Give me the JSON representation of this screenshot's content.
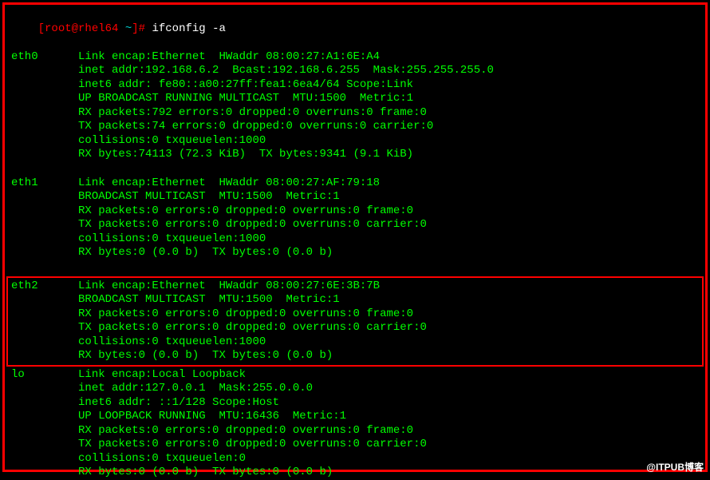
{
  "prompt": {
    "bracket_open": "[",
    "user_host": "root@rhel64",
    "separator": " ",
    "cwd": "~",
    "bracket_close": "]",
    "hash": "# ",
    "command": "ifconfig -a"
  },
  "interfaces": [
    {
      "name": "eth0",
      "lines": [
        "eth0      Link encap:Ethernet  HWaddr 08:00:27:A1:6E:A4",
        "          inet addr:192.168.6.2  Bcast:192.168.6.255  Mask:255.255.255.0",
        "          inet6 addr: fe80::a00:27ff:fea1:6ea4/64 Scope:Link",
        "          UP BROADCAST RUNNING MULTICAST  MTU:1500  Metric:1",
        "          RX packets:792 errors:0 dropped:0 overruns:0 frame:0",
        "          TX packets:74 errors:0 dropped:0 overruns:0 carrier:0",
        "          collisions:0 txqueuelen:1000",
        "          RX bytes:74113 (72.3 KiB)  TX bytes:9341 (9.1 KiB)"
      ],
      "highlighted": false
    },
    {
      "name": "eth1",
      "lines": [
        "eth1      Link encap:Ethernet  HWaddr 08:00:27:AF:79:18",
        "          BROADCAST MULTICAST  MTU:1500  Metric:1",
        "          RX packets:0 errors:0 dropped:0 overruns:0 frame:0",
        "          TX packets:0 errors:0 dropped:0 overruns:0 carrier:0",
        "          collisions:0 txqueuelen:1000",
        "          RX bytes:0 (0.0 b)  TX bytes:0 (0.0 b)"
      ],
      "highlighted": false
    },
    {
      "name": "eth2",
      "lines": [
        "eth2      Link encap:Ethernet  HWaddr 08:00:27:6E:3B:7B",
        "          BROADCAST MULTICAST  MTU:1500  Metric:1",
        "          RX packets:0 errors:0 dropped:0 overruns:0 frame:0",
        "          TX packets:0 errors:0 dropped:0 overruns:0 carrier:0",
        "          collisions:0 txqueuelen:1000",
        "          RX bytes:0 (0.0 b)  TX bytes:0 (0.0 b)"
      ],
      "highlighted": true
    },
    {
      "name": "lo",
      "lines": [
        "lo        Link encap:Local Loopback",
        "          inet addr:127.0.0.1  Mask:255.0.0.0",
        "          inet6 addr: ::1/128 Scope:Host",
        "          UP LOOPBACK RUNNING  MTU:16436  Metric:1",
        "          RX packets:0 errors:0 dropped:0 overruns:0 frame:0",
        "          TX packets:0 errors:0 dropped:0 overruns:0 carrier:0",
        "          collisions:0 txqueuelen:0",
        "          RX bytes:0 (0.0 b)  TX bytes:0 (0.0 b)"
      ],
      "highlighted": false
    }
  ],
  "watermark": "@ITPUB博客"
}
